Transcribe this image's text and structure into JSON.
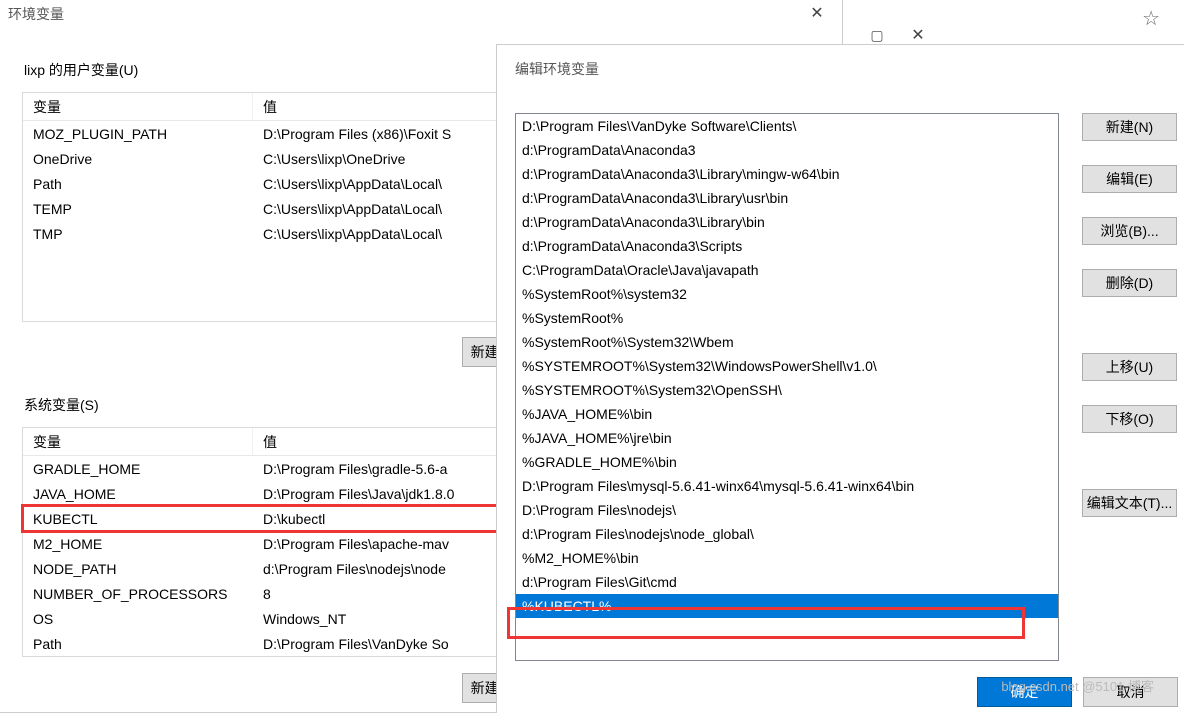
{
  "envWin": {
    "title": "环境变量",
    "userGroup": "lixp 的用户变量(U)",
    "sysGroup": "系统变量(S)",
    "col1": "变量",
    "col2": "值",
    "newBtn": "新建(",
    "userVars": [
      {
        "name": "MOZ_PLUGIN_PATH",
        "value": "D:\\Program Files (x86)\\Foxit S"
      },
      {
        "name": "OneDrive",
        "value": "C:\\Users\\lixp\\OneDrive"
      },
      {
        "name": "Path",
        "value": "C:\\Users\\lixp\\AppData\\Local\\"
      },
      {
        "name": "TEMP",
        "value": "C:\\Users\\lixp\\AppData\\Local\\"
      },
      {
        "name": "TMP",
        "value": "C:\\Users\\lixp\\AppData\\Local\\"
      }
    ],
    "sysVars": [
      {
        "name": "GRADLE_HOME",
        "value": "D:\\Program Files\\gradle-5.6-a"
      },
      {
        "name": "JAVA_HOME",
        "value": "D:\\Program Files\\Java\\jdk1.8.0"
      },
      {
        "name": "KUBECTL",
        "value": "D:\\kubectl",
        "hl": true
      },
      {
        "name": "M2_HOME",
        "value": "D:\\Program Files\\apache-mav"
      },
      {
        "name": "NODE_PATH",
        "value": "d:\\Program Files\\nodejs\\node"
      },
      {
        "name": "NUMBER_OF_PROCESSORS",
        "value": "8"
      },
      {
        "name": "OS",
        "value": "Windows_NT"
      },
      {
        "name": "Path",
        "value": "D:\\Program Files\\VanDyke So"
      }
    ]
  },
  "editWin": {
    "title": "编辑环境变量",
    "buttons": {
      "new": "新建(N)",
      "edit": "编辑(E)",
      "browse": "浏览(B)...",
      "delete": "删除(D)",
      "up": "上移(U)",
      "down": "下移(O)",
      "editText": "编辑文本(T)...",
      "ok": "确定",
      "cancel": "取消"
    },
    "items": [
      {
        "v": "D:\\Program Files\\VanDyke Software\\Clients\\"
      },
      {
        "v": "d:\\ProgramData\\Anaconda3"
      },
      {
        "v": "d:\\ProgramData\\Anaconda3\\Library\\mingw-w64\\bin"
      },
      {
        "v": "d:\\ProgramData\\Anaconda3\\Library\\usr\\bin"
      },
      {
        "v": "d:\\ProgramData\\Anaconda3\\Library\\bin"
      },
      {
        "v": "d:\\ProgramData\\Anaconda3\\Scripts"
      },
      {
        "v": "C:\\ProgramData\\Oracle\\Java\\javapath"
      },
      {
        "v": "%SystemRoot%\\system32"
      },
      {
        "v": "%SystemRoot%"
      },
      {
        "v": "%SystemRoot%\\System32\\Wbem"
      },
      {
        "v": "%SYSTEMROOT%\\System32\\WindowsPowerShell\\v1.0\\"
      },
      {
        "v": "%SYSTEMROOT%\\System32\\OpenSSH\\"
      },
      {
        "v": "%JAVA_HOME%\\bin"
      },
      {
        "v": "%JAVA_HOME%\\jre\\bin"
      },
      {
        "v": "%GRADLE_HOME%\\bin"
      },
      {
        "v": "D:\\Program Files\\mysql-5.6.41-winx64\\mysql-5.6.41-winx64\\bin"
      },
      {
        "v": "D:\\Program Files\\nodejs\\"
      },
      {
        "v": "d:\\Program Files\\nodejs\\node_global\\"
      },
      {
        "v": "%M2_HOME%\\bin"
      },
      {
        "v": "d:\\Program Files\\Git\\cmd"
      },
      {
        "v": "%KUBECTL%",
        "sel": true,
        "hl": true
      }
    ]
  },
  "watermark": "blog.csdn.net   @5101  博客"
}
